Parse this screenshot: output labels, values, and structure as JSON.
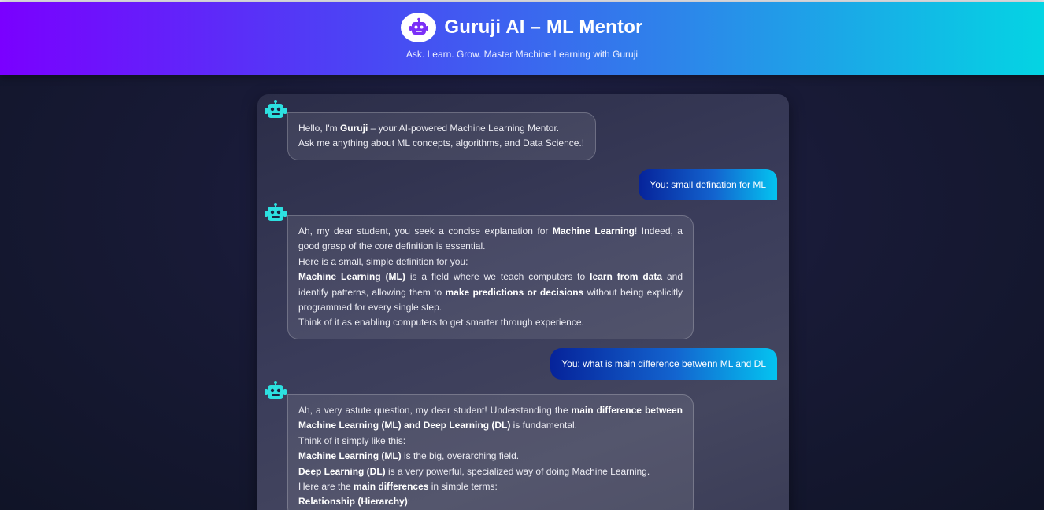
{
  "header": {
    "title": "Guruji AI – ML Mentor",
    "subtitle": "Ask. Learn. Grow. Master Machine Learning with Guruji",
    "logo_icon": "robot-icon"
  },
  "colors": {
    "accent": "#00e5ff",
    "header_gradient": [
      "#7a00ff",
      "#4a46f4",
      "#2d85ea",
      "#04d4e3"
    ],
    "user_bubble_gradient": [
      "#06239a",
      "#1364cf",
      "#04c3f0"
    ]
  },
  "messages": [
    {
      "role": "bot",
      "lines": [
        [
          {
            "t": "Hello, I'm "
          },
          {
            "t": "Guruji",
            "b": true
          },
          {
            "t": " – your AI-powered Machine Learning Mentor."
          }
        ],
        [
          {
            "t": "Ask me anything about ML concepts, algorithms, and Data Science.!"
          }
        ]
      ]
    },
    {
      "role": "user",
      "text": "You: small defination for ML"
    },
    {
      "role": "bot",
      "lines": [
        [
          {
            "t": "Ah, my dear student, you seek a concise explanation for "
          },
          {
            "t": "Machine Learning",
            "b": true
          },
          {
            "t": "! Indeed, a good grasp of the core definition is essential."
          }
        ],
        [
          {
            "t": "Here is a small, simple definition for you:"
          }
        ],
        [
          {
            "t": "Machine Learning (ML)",
            "b": true
          },
          {
            "t": " is a field where we teach computers to "
          },
          {
            "t": "learn from data",
            "b": true
          },
          {
            "t": " and identify patterns, allowing them to "
          },
          {
            "t": "make predictions or decisions",
            "b": true
          },
          {
            "t": " without being explicitly programmed for every single step."
          }
        ],
        [
          {
            "t": "Think of it as enabling computers to get smarter through experience."
          }
        ]
      ]
    },
    {
      "role": "user",
      "text": "You: what is main difference betwenn ML and DL"
    },
    {
      "role": "bot",
      "lines": [
        [
          {
            "t": "Ah, a very astute question, my dear student! Understanding the "
          },
          {
            "t": "main difference between Machine Learning (ML) and Deep Learning (DL)",
            "b": true
          },
          {
            "t": " is fundamental."
          }
        ],
        [
          {
            "t": "Think of it simply like this:"
          }
        ],
        [
          {
            "t": "Machine Learning (ML)",
            "b": true
          },
          {
            "t": " is the big, overarching field."
          }
        ],
        [
          {
            "t": "Deep Learning (DL)",
            "b": true
          },
          {
            "t": " is a very powerful, specialized way of doing Machine Learning."
          }
        ],
        [
          {
            "t": "Here are the "
          },
          {
            "t": "main differences",
            "b": true
          },
          {
            "t": " in simple terms:"
          }
        ],
        [
          {
            "t": "Relationship (Hierarchy)",
            "b": true
          },
          {
            "t": ":"
          }
        ]
      ]
    }
  ]
}
